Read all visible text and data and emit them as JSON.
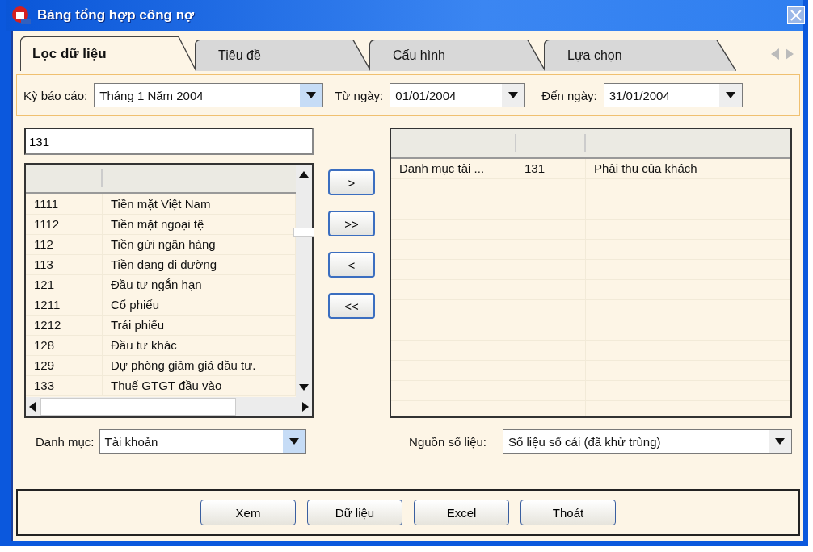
{
  "window": {
    "title": "Bảng tổng hợp công nợ"
  },
  "tabs": [
    {
      "label": "Lọc dữ liệu",
      "selected": true
    },
    {
      "label": "Tiêu đề",
      "selected": false
    },
    {
      "label": "Cấu hình",
      "selected": false
    },
    {
      "label": "Lựa chọn",
      "selected": false
    }
  ],
  "filter": {
    "period_label": "Kỳ báo cáo:",
    "period_value": "Tháng 1 Năm 2004",
    "from_label": "Từ ngày:",
    "from_value": "01/01/2004",
    "to_label": "Đến ngày:",
    "to_value": "31/01/2004"
  },
  "search": {
    "value": "131"
  },
  "source_list": {
    "rows": [
      {
        "code": "1111",
        "name": "Tiền mặt Việt Nam"
      },
      {
        "code": "1112",
        "name": "Tiền mặt ngoại tệ"
      },
      {
        "code": "112",
        "name": "Tiền gửi ngân hàng"
      },
      {
        "code": "113",
        "name": "Tiền đang đi đường"
      },
      {
        "code": "121",
        "name": "Đầu tư ngắn hạn"
      },
      {
        "code": "1211",
        "name": "Cổ phiếu"
      },
      {
        "code": "1212",
        "name": "Trái phiếu"
      },
      {
        "code": "128",
        "name": "Đầu tư khác"
      },
      {
        "code": "129",
        "name": "Dự phòng giảm giá đầu tư."
      },
      {
        "code": "133",
        "name": "Thuế GTGT đầu vào"
      }
    ]
  },
  "move_buttons": [
    ">",
    ">>",
    "<",
    "<<"
  ],
  "selected_list": {
    "rows": [
      {
        "column_1": "Danh mục tài ...",
        "column_2": "131",
        "column_3": "Phải thu của khách"
      }
    ]
  },
  "category": {
    "label": "Danh mục:",
    "value": "Tài khoản"
  },
  "data_source": {
    "label": "Nguồn số liệu:",
    "value": "Số liệu sổ cái (đã khử trùng)"
  },
  "buttons": [
    "Xem",
    "Dữ liệu",
    "Excel",
    "Thoát"
  ]
}
